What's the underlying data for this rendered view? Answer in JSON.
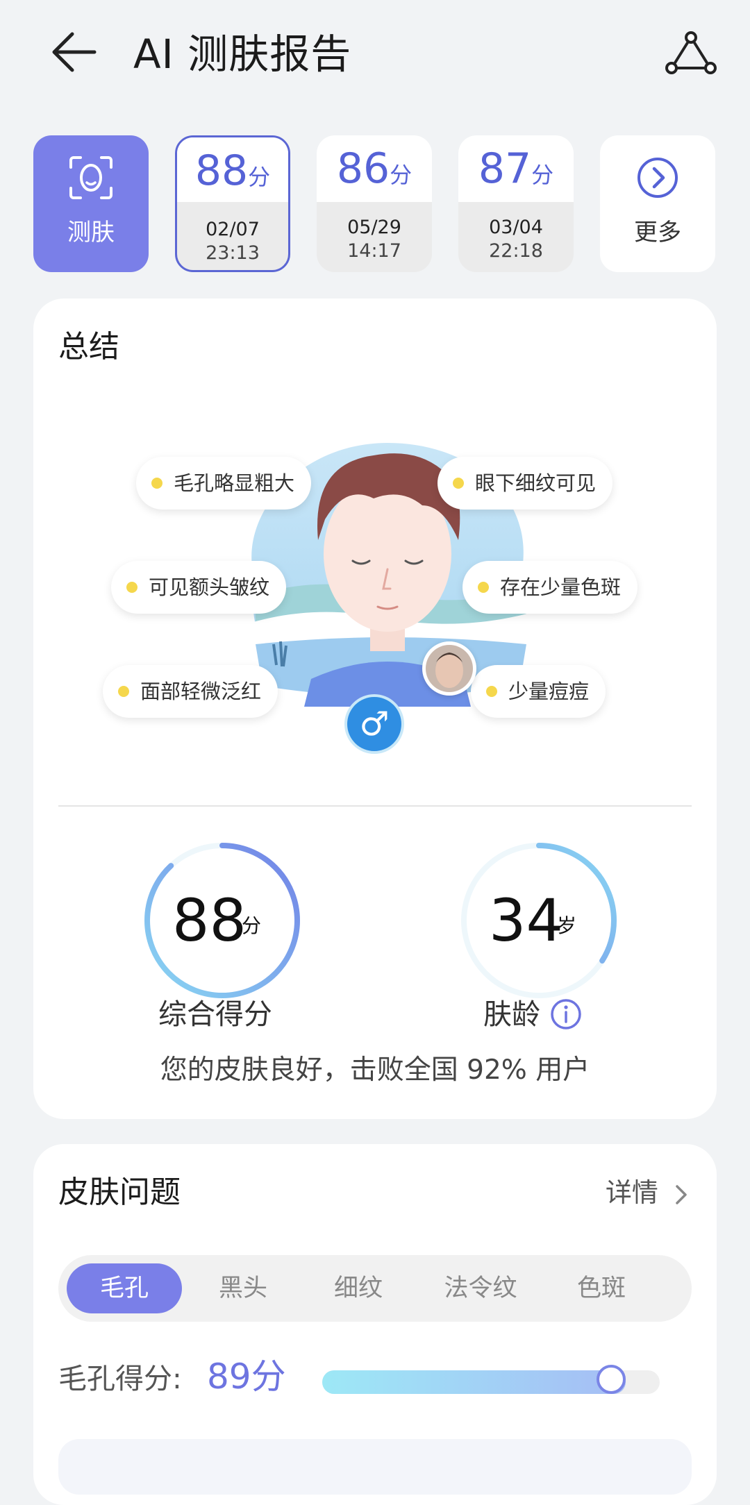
{
  "header": {
    "title": "AI 测肤报告",
    "back_icon": "arrow-left-icon",
    "share_icon": "share-icon"
  },
  "history": {
    "scan_label": "测肤",
    "reports": [
      {
        "score": "88",
        "unit": "分",
        "date": "02/07",
        "time": "23:13",
        "selected": true
      },
      {
        "score": "86",
        "unit": "分",
        "date": "05/29",
        "time": "14:17",
        "selected": false
      },
      {
        "score": "87",
        "unit": "分",
        "date": "03/04",
        "time": "22:18",
        "selected": false
      }
    ],
    "more_label": "更多"
  },
  "summary": {
    "title": "总结",
    "tags": [
      "毛孔略显粗大",
      "眼下细纹可见",
      "可见额头皱纹",
      "存在少量色斑",
      "面部轻微泛红",
      "少量痘痘"
    ],
    "gender_symbol": "♂",
    "overall": {
      "value": "88",
      "unit": "分",
      "label": "综合得分",
      "fraction": 0.88
    },
    "skin_age": {
      "value": "34",
      "unit": "岁",
      "label": "肤龄",
      "fraction": 0.34
    },
    "text": "您的皮肤良好，击败全国 92% 用户"
  },
  "problems": {
    "title": "皮肤问题",
    "detail_label": "详情",
    "tabs": [
      "毛孔",
      "黑头",
      "细纹",
      "法令纹",
      "色斑"
    ],
    "active_tab": 0,
    "pore_label": "毛孔得分:",
    "pore_score": "89分",
    "pore_fraction": 0.89
  },
  "colors": {
    "accent": "#7a7fe8",
    "score_blue": "#5562d6",
    "tag_dot": "#f5d74c"
  }
}
